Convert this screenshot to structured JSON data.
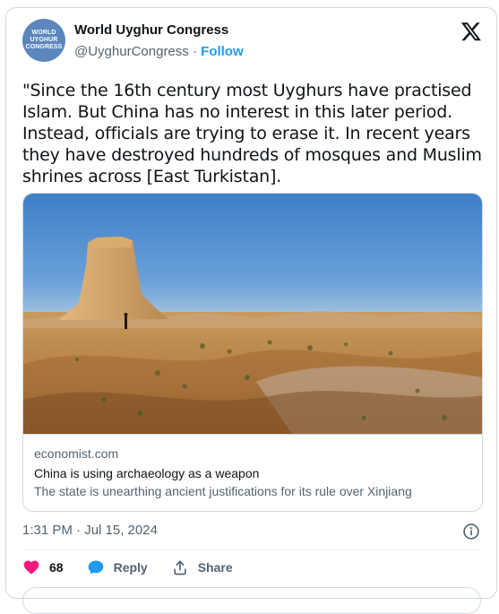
{
  "author": {
    "avatar_text": [
      "WORLD",
      "UYGHUR",
      "CONGRESS"
    ],
    "name": "World Uyghur Congress",
    "handle": "@UyghurCongress",
    "separator": "·",
    "follow_label": "Follow"
  },
  "tweet": {
    "text": "\"Since the 16th century most Uyghurs have practised Islam. But China has no interest in this later period. Instead, officials are trying to erase it. In recent years they have destroyed hundreds of mosques and Muslim shrines across [East Turkistan].",
    "timestamp": "1:31 PM · Jul 15, 2024"
  },
  "link_card": {
    "domain": "economist.com",
    "title": "China is using archaeology as a weapon",
    "description": "The state is unearthing ancient justifications for its rule over Xinjiang"
  },
  "actions": {
    "like_count": "68",
    "reply_label": "Reply",
    "share_label": "Share"
  },
  "colors": {
    "accent": "#1d9bf0",
    "like": "#f91880",
    "text_secondary": "#536471"
  },
  "icons": [
    "x-logo-icon",
    "heart-icon",
    "reply-bubble-icon",
    "share-icon",
    "info-icon"
  ]
}
